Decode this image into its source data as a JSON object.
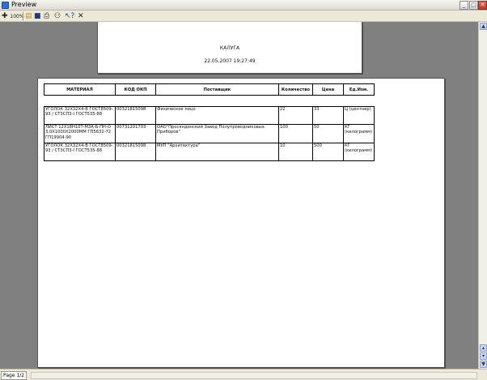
{
  "window": {
    "title": "Preview"
  },
  "toolbar": {
    "zoom_label": "100%",
    "icons": [
      "zoom-icon",
      "open-icon",
      "save-icon",
      "print-icon",
      "find-icon",
      "help-icon",
      "close-icon"
    ]
  },
  "report_header": {
    "city": "КАЛУГА",
    "date": "22.05.2007 19:27:49"
  },
  "table": {
    "headers": [
      "МАТЕРИАЛ",
      "КОД ОКП",
      "Поставщик",
      "Количество",
      "Цена",
      "Ед.Изм."
    ],
    "rows": [
      [
        "УГОЛОК 32Х32Х4-В ГОСТ8509-93 / СТ3СП3-I ГОСТ535-88",
        "00321815098",
        "Физическое лицо",
        "22",
        "33",
        "Ц (центнер)"
      ],
      [
        "ЛИСТ 12Х18Н10Т-М3А-Б-ПН-О 3,0Х1000Х2000ММ ГП5632-72 ГП19904-90",
        "00731201703",
        "ОАО\"Просяндинский Завод Полупроводниковых Приборов\"",
        "100",
        "50",
        "КГ (килограмм)"
      ],
      [
        "УГОЛОК 32Х32Х4-В ГОСТ8509-93 / СТ3СП3-I ГОСТ535-88",
        "00321815098",
        "МУП \"Архитектура\"",
        "10",
        "500",
        "КГ (килограмм)"
      ]
    ]
  },
  "status": {
    "page": "Page 1/2"
  }
}
